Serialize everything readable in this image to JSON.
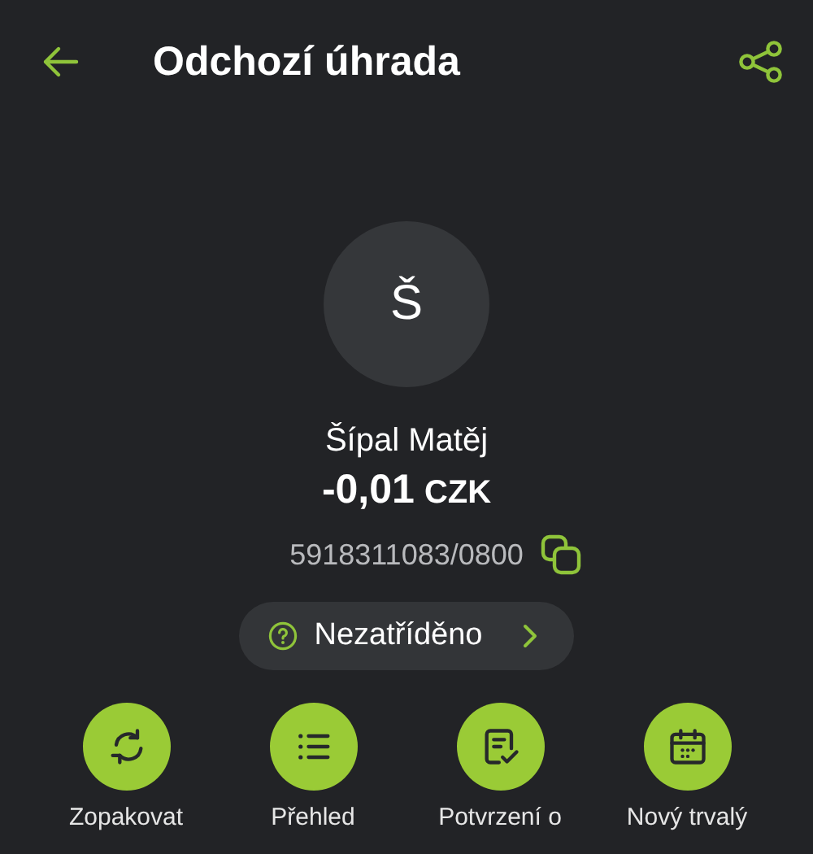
{
  "header": {
    "title": "Odchozí úhrada"
  },
  "counterparty": {
    "initial": "Š",
    "name": "Šípal Matěj",
    "amount": "-0,01",
    "currency": "CZK",
    "account": "5918311083/0800"
  },
  "category": {
    "label": "Nezatříděno"
  },
  "actions": [
    {
      "kind": "repeat",
      "label": "Zopakovat"
    },
    {
      "kind": "list",
      "label": "Přehled"
    },
    {
      "kind": "confirm",
      "label": "Potvrzení o"
    },
    {
      "kind": "calendar",
      "label": "Nový trvalý"
    }
  ]
}
